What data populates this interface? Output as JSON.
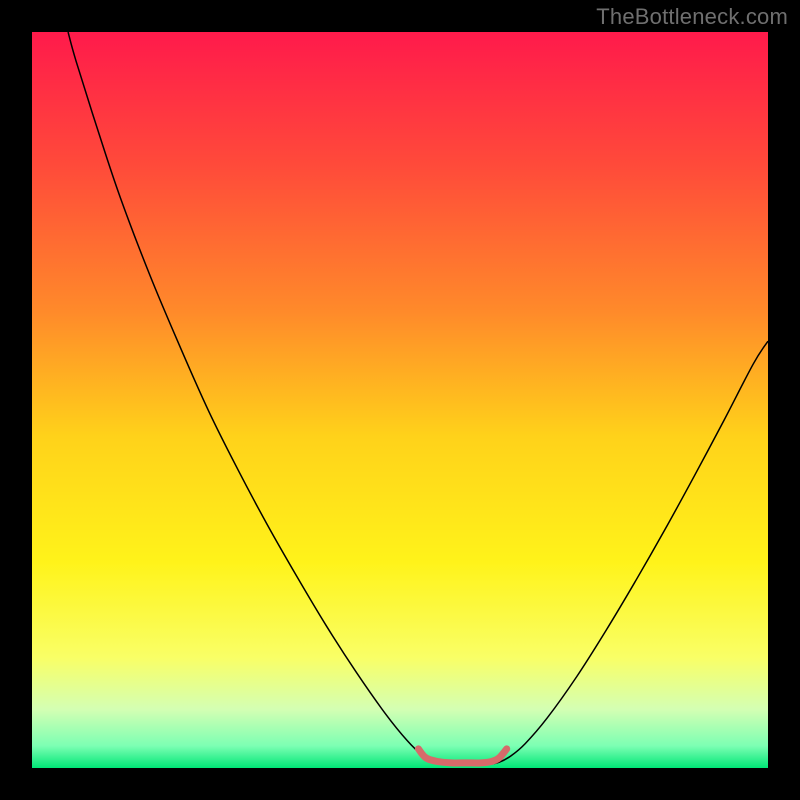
{
  "watermark": {
    "text": "TheBottleneck.com"
  },
  "chart_data": {
    "type": "line",
    "title": "",
    "xlabel": "",
    "ylabel": "",
    "xlim": [
      0,
      100
    ],
    "ylim": [
      0,
      100
    ],
    "grid": false,
    "legend": false,
    "background": {
      "type": "vertical-gradient",
      "stops": [
        {
          "offset": 0.0,
          "color": "#ff1a4b"
        },
        {
          "offset": 0.18,
          "color": "#ff4a3a"
        },
        {
          "offset": 0.38,
          "color": "#ff8a2a"
        },
        {
          "offset": 0.55,
          "color": "#ffd21a"
        },
        {
          "offset": 0.72,
          "color": "#fff31a"
        },
        {
          "offset": 0.85,
          "color": "#f9ff66"
        },
        {
          "offset": 0.92,
          "color": "#d4ffb3"
        },
        {
          "offset": 0.97,
          "color": "#7cffb3"
        },
        {
          "offset": 1.0,
          "color": "#00e676"
        }
      ]
    },
    "series": [
      {
        "name": "bottleneck-curve",
        "stroke": "#000000",
        "stroke_width": 1.5,
        "points": [
          {
            "x": 4.9,
            "y": 100.0
          },
          {
            "x": 6.0,
            "y": 96.0
          },
          {
            "x": 9.0,
            "y": 86.5
          },
          {
            "x": 12.0,
            "y": 77.5
          },
          {
            "x": 16.0,
            "y": 67.0
          },
          {
            "x": 20.0,
            "y": 57.5
          },
          {
            "x": 24.0,
            "y": 48.5
          },
          {
            "x": 28.0,
            "y": 40.5
          },
          {
            "x": 32.0,
            "y": 33.0
          },
          {
            "x": 36.0,
            "y": 26.0
          },
          {
            "x": 40.0,
            "y": 19.3
          },
          {
            "x": 44.0,
            "y": 13.1
          },
          {
            "x": 48.0,
            "y": 7.4
          },
          {
            "x": 51.0,
            "y": 3.7
          },
          {
            "x": 53.0,
            "y": 1.8
          },
          {
            "x": 55.0,
            "y": 0.8
          },
          {
            "x": 56.5,
            "y": 0.5
          },
          {
            "x": 58.5,
            "y": 0.5
          },
          {
            "x": 60.0,
            "y": 0.4
          },
          {
            "x": 62.0,
            "y": 0.5
          },
          {
            "x": 63.5,
            "y": 0.8
          },
          {
            "x": 65.0,
            "y": 1.6
          },
          {
            "x": 67.0,
            "y": 3.3
          },
          {
            "x": 70.0,
            "y": 6.8
          },
          {
            "x": 74.0,
            "y": 12.4
          },
          {
            "x": 78.0,
            "y": 18.7
          },
          {
            "x": 82.0,
            "y": 25.4
          },
          {
            "x": 86.0,
            "y": 32.4
          },
          {
            "x": 90.0,
            "y": 39.7
          },
          {
            "x": 94.0,
            "y": 47.2
          },
          {
            "x": 98.0,
            "y": 54.9
          },
          {
            "x": 100.0,
            "y": 58.0
          }
        ]
      },
      {
        "name": "optimal-range-marker",
        "stroke": "#d66a6a",
        "stroke_width": 7,
        "linecap": "round",
        "points": [
          {
            "x": 52.5,
            "y": 2.6
          },
          {
            "x": 53.5,
            "y": 1.4
          },
          {
            "x": 55.0,
            "y": 0.9
          },
          {
            "x": 57.0,
            "y": 0.7
          },
          {
            "x": 59.0,
            "y": 0.7
          },
          {
            "x": 61.0,
            "y": 0.7
          },
          {
            "x": 62.5,
            "y": 0.9
          },
          {
            "x": 63.5,
            "y": 1.4
          },
          {
            "x": 64.5,
            "y": 2.6
          }
        ]
      }
    ]
  }
}
